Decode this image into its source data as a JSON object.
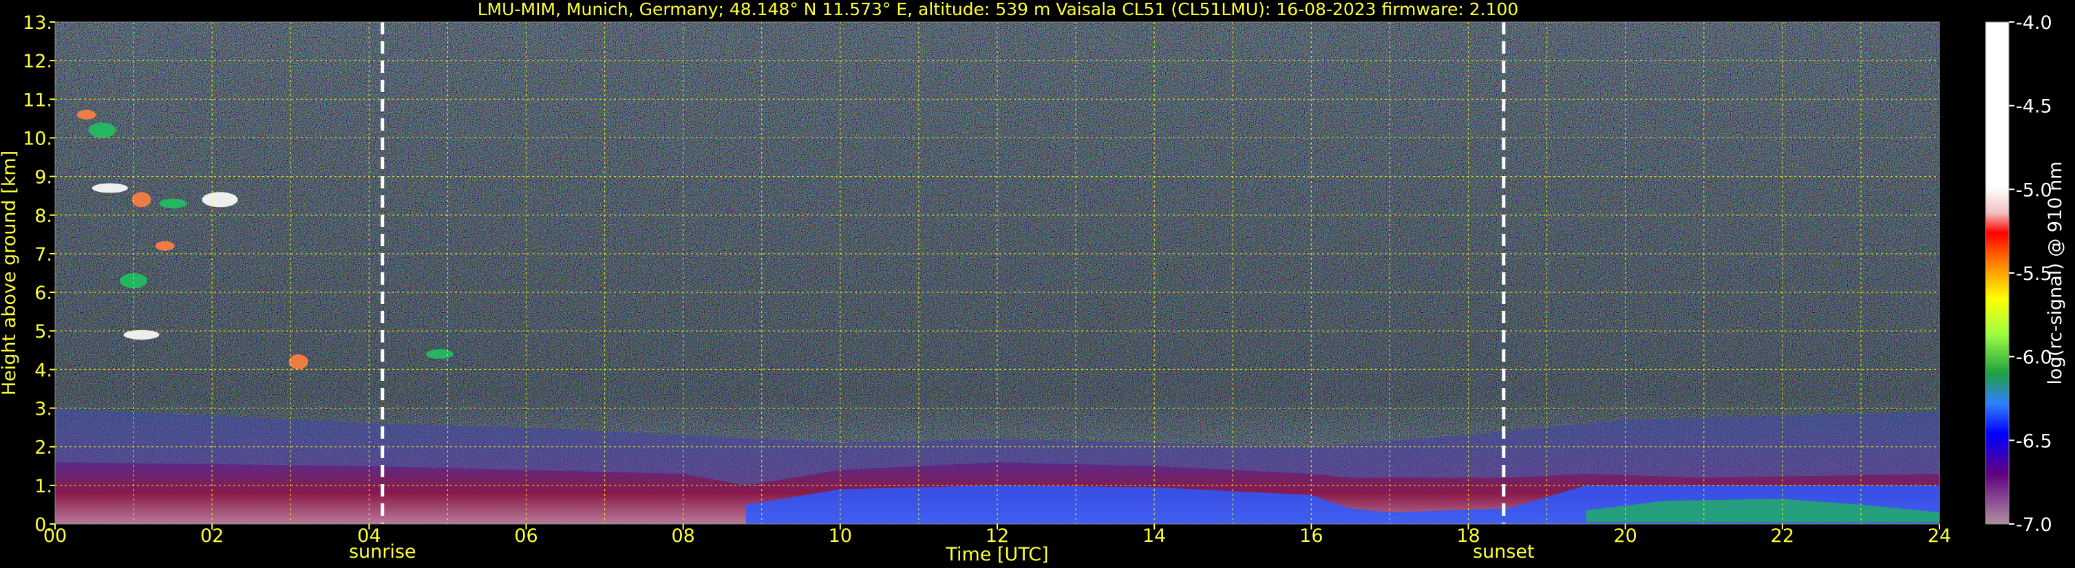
{
  "colors": {
    "background": "#000000",
    "text": "#ffff33",
    "grid": "#ffff00",
    "colorbar_label": "#ffffff",
    "event_line": "#ffffff"
  },
  "chart_data": {
    "type": "heatmap",
    "title": "LMU-MIM, Munich, Germany; 48.148° N 11.573° E, altitude: 539 m    Vaisala CL51 (CL51LMU): 16-08-2023    firmware: 2.100",
    "xlabel": "Time [UTC]",
    "ylabel": "Height above ground [km]",
    "xlim": [
      0,
      24
    ],
    "ylim": [
      0,
      13
    ],
    "x_ticks": [
      0,
      2,
      4,
      6,
      8,
      10,
      12,
      14,
      16,
      18,
      20,
      22,
      24
    ],
    "x_tick_labels": [
      "00",
      "02",
      "04",
      "06",
      "08",
      "10",
      "12",
      "14",
      "16",
      "18",
      "20",
      "22",
      "24"
    ],
    "y_ticks": [
      0,
      1,
      2,
      3,
      4,
      5,
      6,
      7,
      8,
      9,
      10,
      11,
      12,
      13
    ],
    "y_tick_labels": [
      "0.",
      "1.",
      "2.",
      "3.",
      "4.",
      "5.",
      "6.",
      "7.",
      "8.",
      "9.",
      "10.",
      "11.",
      "12.",
      "13."
    ],
    "grid": true,
    "events": [
      {
        "label": "sunrise",
        "time": 4.17
      },
      {
        "label": "sunset",
        "time": 18.45
      }
    ],
    "colorbar": {
      "label": "log(rc-signal) @ 910 nm",
      "range": [
        -7.0,
        -4.0
      ],
      "ticks": [
        -4.0,
        -4.5,
        -5.0,
        -5.5,
        -6.0,
        -6.5,
        -7.0
      ],
      "tick_labels": [
        "-4.0",
        "-4.5",
        "-5.0",
        "-5.5",
        "-6.0",
        "-6.5",
        "-7.0"
      ]
    },
    "layers": [
      {
        "kind": "boundary_layer",
        "t": [
          0,
          4,
          6,
          8,
          8.8,
          10,
          12,
          14,
          16,
          16.5,
          18.5,
          19.5,
          21,
          24
        ],
        "top_km": [
          1.6,
          1.5,
          1.4,
          1.3,
          1.0,
          1.4,
          1.6,
          1.5,
          1.3,
          1.2,
          1.2,
          1.3,
          1.2,
          1.3
        ]
      },
      {
        "kind": "residual_layer",
        "t": [
          0,
          4,
          6,
          8,
          10,
          12,
          14,
          16,
          18,
          20,
          22,
          24
        ],
        "top_km": [
          3.0,
          2.6,
          2.5,
          2.3,
          2.1,
          2.2,
          2.1,
          2.0,
          2.3,
          2.7,
          2.8,
          2.9
        ]
      },
      {
        "kind": "cirrus",
        "points": [
          {
            "t": 0.4,
            "h": 10.6
          },
          {
            "t": 0.6,
            "h": 10.2
          },
          {
            "t": 0.7,
            "h": 8.7
          },
          {
            "t": 1.1,
            "h": 8.4
          },
          {
            "t": 1.5,
            "h": 8.3
          },
          {
            "t": 2.1,
            "h": 8.4
          },
          {
            "t": 1.4,
            "h": 7.2
          },
          {
            "t": 1.0,
            "h": 6.3
          },
          {
            "t": 1.1,
            "h": 4.9
          },
          {
            "t": 3.1,
            "h": 4.2
          },
          {
            "t": 4.9,
            "h": 4.4
          }
        ]
      }
    ]
  }
}
